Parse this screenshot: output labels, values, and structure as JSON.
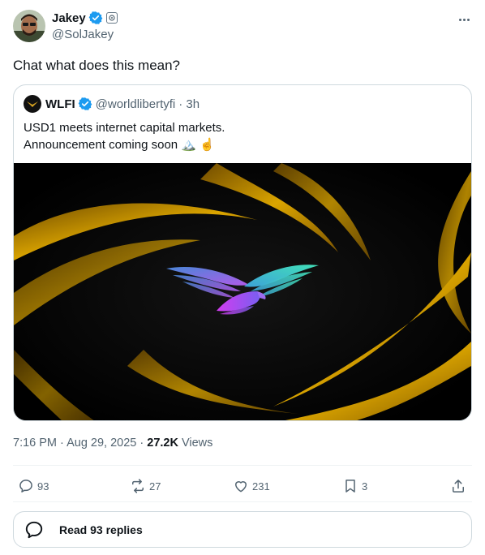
{
  "author": {
    "name": "Jakey",
    "handle": "@SolJakey"
  },
  "tweet": {
    "text": "Chat what does this mean?"
  },
  "quoted": {
    "name": "WLFI",
    "handle": "@worldlibertyfi",
    "time": "· 3h",
    "line1": "USD1 meets internet capital markets.",
    "line2": "Announcement coming soon",
    "emojis": "🏔️ ☝️"
  },
  "meta": {
    "time": "7:16 PM · Aug 29, 2025 · ",
    "views": "27.2K",
    "views_label": " Views"
  },
  "actions": {
    "replies": "93",
    "reposts": "27",
    "likes": "231",
    "bookmarks": "3"
  },
  "read_replies": "Read 93 replies",
  "colors": {
    "verified": "#1d9bf0",
    "text": "#0f1419",
    "muted": "#536471",
    "border": "#cfd9de",
    "gold": "#e0a400"
  }
}
